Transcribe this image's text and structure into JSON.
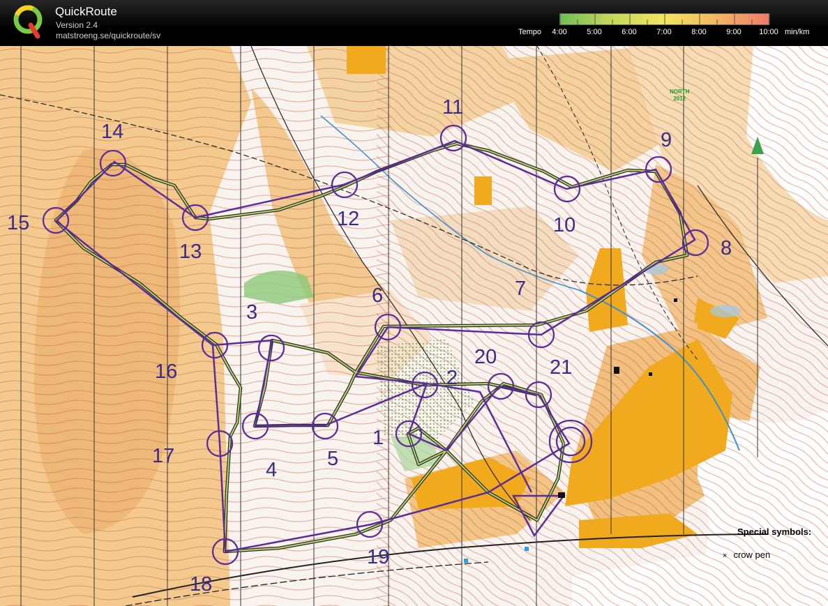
{
  "header": {
    "app_title": "QuickRoute",
    "app_version": "Version 2.4",
    "app_url": "matstroeng.se/quickroute/sv"
  },
  "pace_legend": {
    "label": "Tempo",
    "ticks": [
      "4:00",
      "5:00",
      "6:00",
      "7:00",
      "8:00",
      "9:00",
      "10:00"
    ],
    "unit": "min/km",
    "gradient_colors": [
      "#6fbf55",
      "#c7d85a",
      "#f2e55e",
      "#f3b760",
      "#ef7a6a"
    ]
  },
  "map": {
    "north_label_1": "NORTH",
    "north_label_2": "2012",
    "special_symbols_heading": "Special symbols:",
    "special_symbol_mark": "×",
    "special_symbol_label": "crow pen",
    "course_color": "#5b2c9a",
    "controls": [
      {
        "id": "c1",
        "label": "1"
      },
      {
        "id": "c2",
        "label": "2"
      },
      {
        "id": "c3",
        "label": "3"
      },
      {
        "id": "c4",
        "label": "4"
      },
      {
        "id": "c5",
        "label": "5"
      },
      {
        "id": "c6",
        "label": "6"
      },
      {
        "id": "c7",
        "label": "7"
      },
      {
        "id": "c8",
        "label": "8"
      },
      {
        "id": "c9",
        "label": "9"
      },
      {
        "id": "c10",
        "label": "10"
      },
      {
        "id": "c11",
        "label": "11"
      },
      {
        "id": "c12",
        "label": "12"
      },
      {
        "id": "c13",
        "label": "13"
      },
      {
        "id": "c14",
        "label": "14"
      },
      {
        "id": "c15",
        "label": "15"
      },
      {
        "id": "c16",
        "label": "16"
      },
      {
        "id": "c17",
        "label": "17"
      },
      {
        "id": "c18",
        "label": "18"
      },
      {
        "id": "c19",
        "label": "19"
      },
      {
        "id": "c20",
        "label": "20"
      },
      {
        "id": "c21",
        "label": "21"
      }
    ]
  }
}
